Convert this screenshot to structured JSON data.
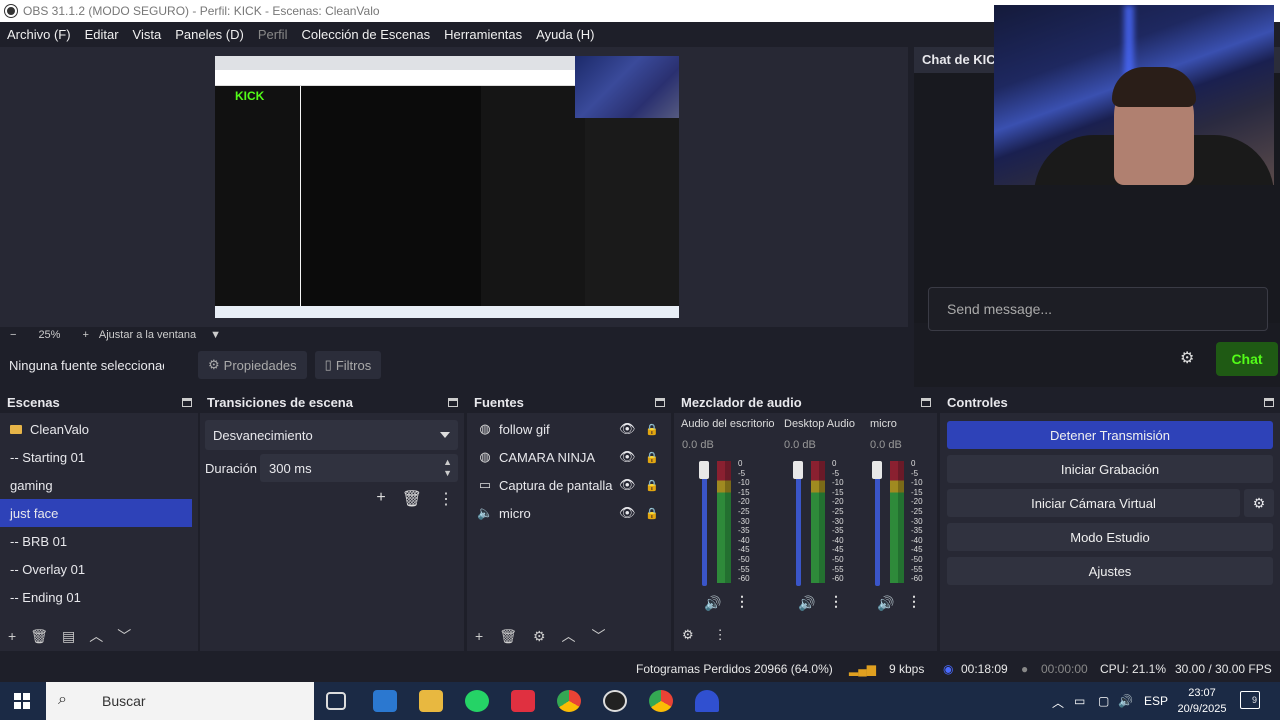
{
  "window": {
    "title": "OBS 31.1.2 (MODO SEGURO) - Perfil: KICK - Escenas: CleanValo"
  },
  "menu": [
    {
      "label": "Archivo (F)",
      "disabled": false
    },
    {
      "label": "Editar",
      "disabled": false
    },
    {
      "label": "Vista",
      "disabled": false
    },
    {
      "label": "Paneles (D)",
      "disabled": false
    },
    {
      "label": "Perfil",
      "disabled": true
    },
    {
      "label": "Colección de Escenas",
      "disabled": false
    },
    {
      "label": "Herramientas",
      "disabled": false
    },
    {
      "label": "Ayuda (H)",
      "disabled": false
    }
  ],
  "preview": {
    "zoom": "25%",
    "fit_label": "Ajustar a la ventana",
    "kick_logo": "KICK"
  },
  "source_bar": {
    "no_source": "Ninguna fuente seleccionada",
    "properties": "Propiedades",
    "filters": "Filtros"
  },
  "chat": {
    "title": "Chat de KICK",
    "placeholder": "Send message...",
    "send_label": "Chat",
    "accent": "#53fc18"
  },
  "scenes": {
    "title": "Escenas",
    "items": [
      {
        "label": "CleanValo",
        "folder": true,
        "selected": false
      },
      {
        "label": "-- Starting 01",
        "folder": false,
        "selected": false
      },
      {
        "label": "gaming",
        "folder": false,
        "selected": false
      },
      {
        "label": "just face",
        "folder": false,
        "selected": true
      },
      {
        "label": "-- BRB 01",
        "folder": false,
        "selected": false
      },
      {
        "label": "-- Overlay 01",
        "folder": false,
        "selected": false
      },
      {
        "label": "-- Ending 01",
        "folder": false,
        "selected": false
      }
    ]
  },
  "transitions": {
    "title": "Transiciones de escena",
    "selected": "Desvanecimiento",
    "duration_label": "Duración",
    "duration_value": "300 ms"
  },
  "sources": {
    "title": "Fuentes",
    "items": [
      {
        "label": "follow gif",
        "icon": "globe-icon"
      },
      {
        "label": "CAMARA NINJA",
        "icon": "globe-icon"
      },
      {
        "label": "Captura de pantalla",
        "icon": "monitor-icon"
      },
      {
        "label": "micro",
        "icon": "speaker-icon"
      }
    ]
  },
  "mixer": {
    "title": "Mezclador de audio",
    "channels": [
      {
        "name": "Audio del escritorio",
        "db": "0.0 dB"
      },
      {
        "name": "Desktop Audio",
        "db": "0.0 dB"
      },
      {
        "name": "micro",
        "db": "0.0 dB"
      }
    ],
    "scale": [
      "0",
      "-5",
      "-10",
      "-15",
      "-20",
      "-25",
      "-30",
      "-35",
      "-40",
      "-45",
      "-50",
      "-55",
      "-60"
    ]
  },
  "controls": {
    "title": "Controles",
    "stop_stream": "Detener Transmisión",
    "start_recording": "Iniciar Grabación",
    "start_virtual_cam": "Iniciar Cámara Virtual",
    "studio_mode": "Modo Estudio",
    "settings": "Ajustes",
    "accent": "#2e42b8"
  },
  "status": {
    "dropped_frames": "Fotogramas Perdidos 20966 (64.0%)",
    "bitrate": "9 kbps",
    "stream_time": "00:18:09",
    "rec_time": "00:00:00",
    "cpu": "CPU: 21.1%",
    "fps": "30.00 / 30.00 FPS"
  },
  "taskbar": {
    "search_placeholder": "Buscar",
    "lang": "ESP",
    "time": "23:07",
    "date": "20/9/2025",
    "notifications": "9"
  }
}
